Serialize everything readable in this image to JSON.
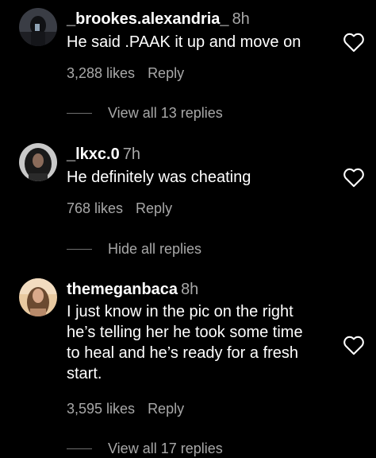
{
  "comments": [
    {
      "username": "_brookes.alexandria_",
      "time": "8h",
      "text": "He said .PAAK it up and move on",
      "likes": "3,288 likes",
      "reply_label": "Reply",
      "replies_toggle": "View all 13 replies",
      "avatar_icon": "avatar-icon"
    },
    {
      "username": "_lkxc.0",
      "time": "7h",
      "text": "He definitely was cheating",
      "likes": "768 likes",
      "reply_label": "Reply",
      "replies_toggle": "Hide all replies",
      "avatar_icon": "avatar-icon"
    },
    {
      "username": "themeganbaca",
      "time": "8h",
      "text": "I just know in the pic on the right\nhe’s telling her he took some time\nto heal and he’s ready for a fresh\nstart.",
      "likes": "3,595 likes",
      "reply_label": "Reply",
      "replies_toggle": "View all 17 replies",
      "avatar_icon": "avatar-icon"
    }
  ],
  "like_icon": "heart-outline-icon",
  "colors": {
    "background": "#000000",
    "primary_text": "#ffffff",
    "secondary_text": "#a8a8a8",
    "divider": "#6f6f6f"
  }
}
